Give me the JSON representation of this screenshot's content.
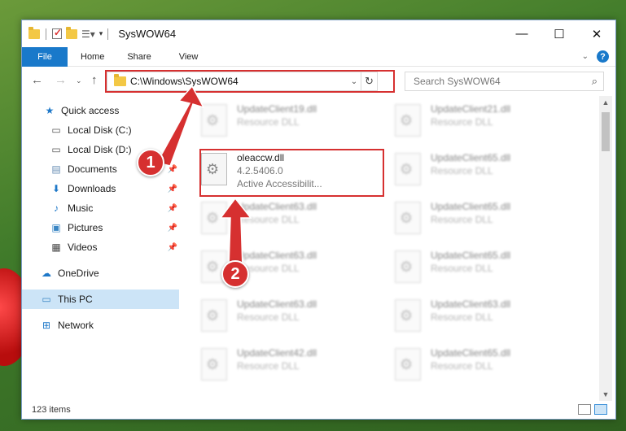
{
  "window": {
    "title": "SysWOW64"
  },
  "ribbon": {
    "tabs": [
      "File",
      "Home",
      "Share",
      "View"
    ]
  },
  "nav": {
    "address": "C:\\Windows\\SysWOW64",
    "search_placeholder": "Search SysWOW64"
  },
  "sidebar": {
    "items": [
      {
        "label": "Quick access",
        "icon": "star-icon",
        "pinned": false
      },
      {
        "label": "Local Disk (C:)",
        "icon": "drive-icon",
        "pinned": false
      },
      {
        "label": "Local Disk (D:)",
        "icon": "drive-icon",
        "pinned": true
      },
      {
        "label": "Documents",
        "icon": "documents-icon",
        "pinned": true
      },
      {
        "label": "Downloads",
        "icon": "download-icon",
        "pinned": true
      },
      {
        "label": "Music",
        "icon": "music-icon",
        "pinned": true
      },
      {
        "label": "Pictures",
        "icon": "pictures-icon",
        "pinned": true
      },
      {
        "label": "Videos",
        "icon": "videos-icon",
        "pinned": true
      },
      {
        "label": "OneDrive",
        "icon": "cloud-icon",
        "pinned": false
      },
      {
        "label": "This PC",
        "icon": "computer-icon",
        "pinned": false
      },
      {
        "label": "Network",
        "icon": "network-icon",
        "pinned": false
      }
    ]
  },
  "files": [
    {
      "name": "UpdateClient19.dll",
      "line2": "Resource DLL",
      "highlight": false
    },
    {
      "name": "UpdateClient21.dll",
      "line2": "Resource DLL",
      "highlight": false
    },
    {
      "name": "oleaccw.dll",
      "line2": "4.2.5406.0",
      "line3": "Active Accessibilit...",
      "highlight": true
    },
    {
      "name": "UpdateClient65.dll",
      "line2": "Resource DLL",
      "highlight": false
    },
    {
      "name": "UpdateClient63.dll",
      "line2": "Resource DLL",
      "highlight": false
    },
    {
      "name": "UpdateClient65.dll",
      "line2": "Resource DLL",
      "highlight": false
    },
    {
      "name": "UpdateClient63.dll",
      "line2": "Resource DLL",
      "highlight": false
    },
    {
      "name": "UpdateClient65.dll",
      "line2": "Resource DLL",
      "highlight": false
    },
    {
      "name": "UpdateClient63.dll",
      "line2": "Resource DLL",
      "highlight": false
    },
    {
      "name": "UpdateClient63.dll",
      "line2": "Resource DLL",
      "highlight": false
    },
    {
      "name": "UpdateClient42.dll",
      "line2": "Resource DLL",
      "highlight": false
    },
    {
      "name": "UpdateClient65.dll",
      "line2": "Resource DLL",
      "highlight": false
    }
  ],
  "status": {
    "item_count": "123 items"
  },
  "annotations": {
    "step1": "1",
    "step2": "2",
    "color": "#d63030"
  }
}
